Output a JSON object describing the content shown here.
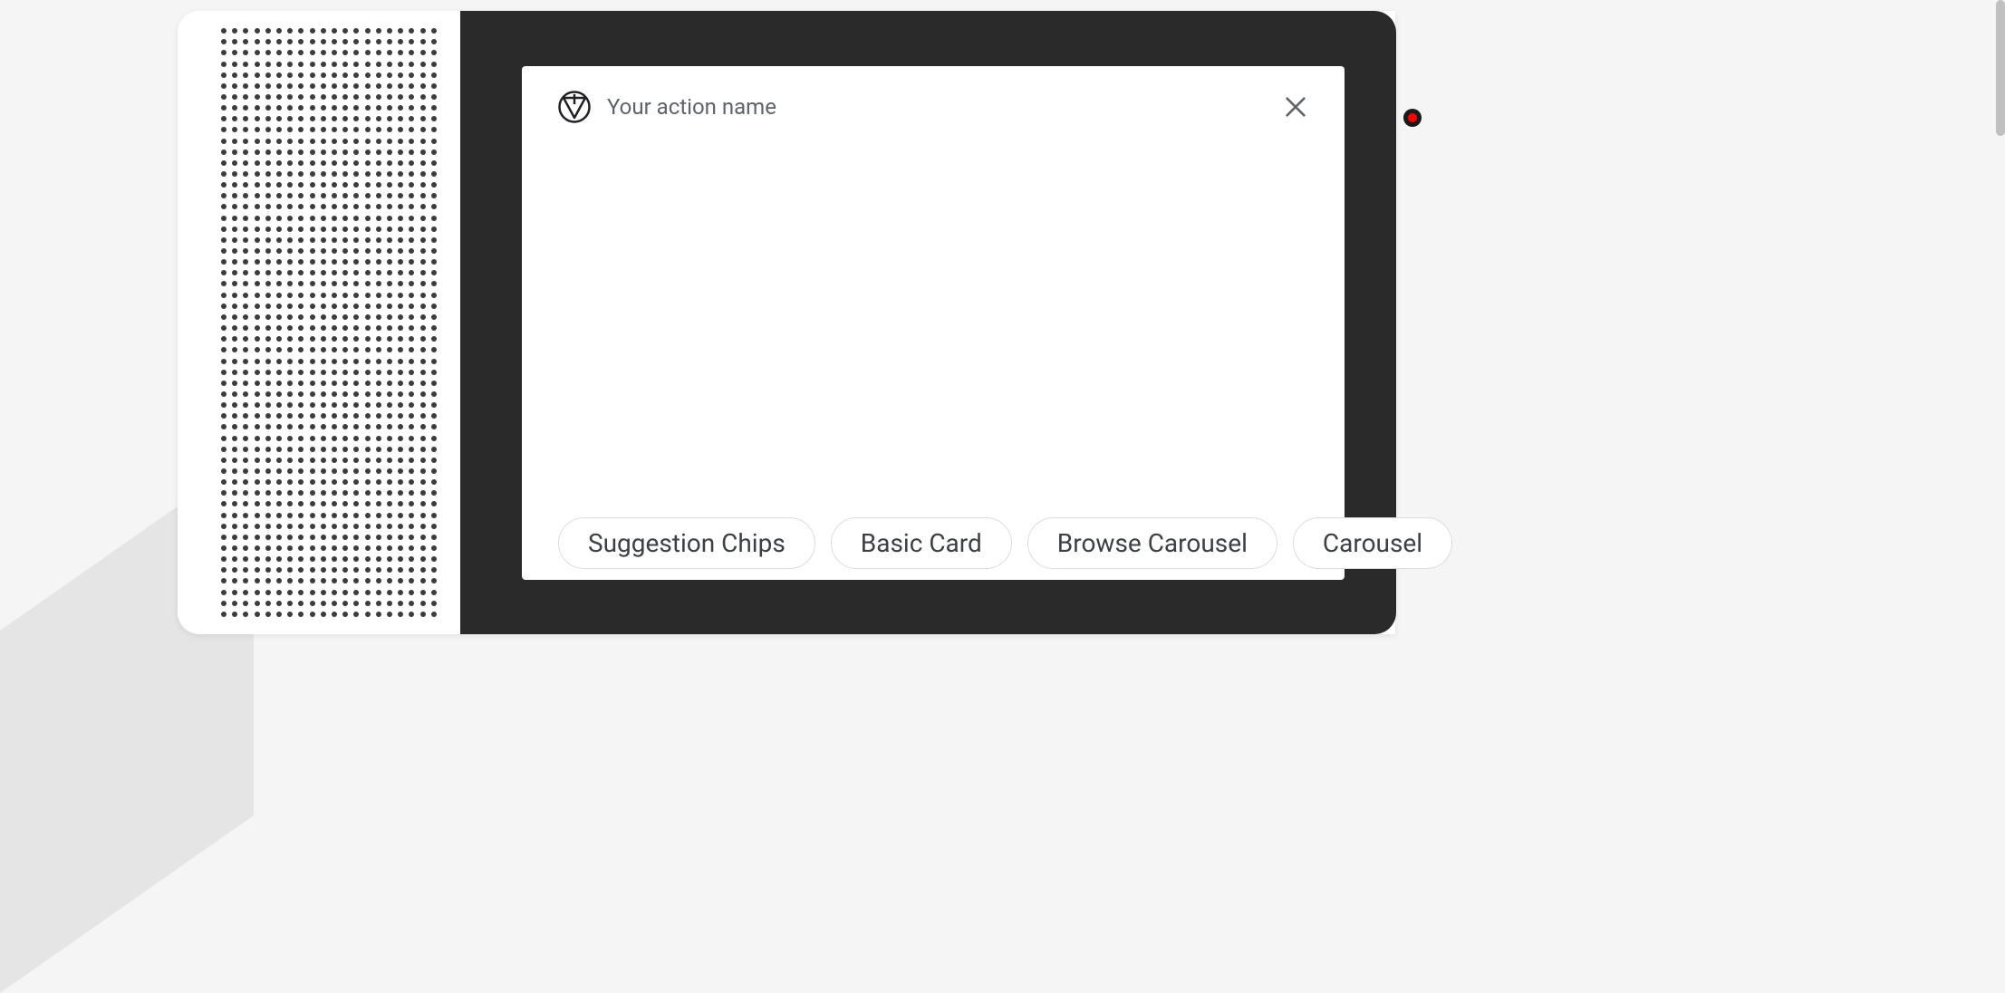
{
  "header": {
    "app_title": "Your action name",
    "app_icon_name": "material-icon",
    "close_icon_name": "close-icon"
  },
  "chips": [
    {
      "label": "Suggestion Chips"
    },
    {
      "label": "Basic Card"
    },
    {
      "label": "Browse Carousel"
    },
    {
      "label": "Carousel"
    }
  ]
}
